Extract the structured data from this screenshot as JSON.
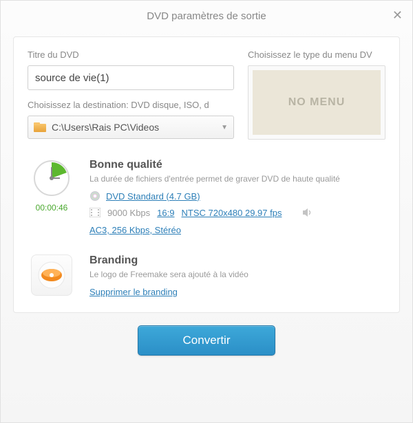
{
  "window": {
    "title": "DVD paramètres de sortie"
  },
  "labels": {
    "dvd_title": "Titre du DVD",
    "menu_type": "Choisissez le type du menu DV",
    "destination": "Choisissez la destination: DVD disque, ISO, d",
    "no_menu": "NO MENU"
  },
  "fields": {
    "title_value": "source de vie(1)",
    "destination_value": "C:\\Users\\Rais PC\\Videos"
  },
  "quality": {
    "title": "Bonne qualité",
    "subtitle": "La durée de fichiers d'entrée permet de graver DVD de haute qualité",
    "duration": "00:00:46",
    "disc_spec": "DVD Standard (4.7 GB)",
    "bitrate": "9000 Kbps",
    "aspect": "16:9",
    "video_std": "NTSC 720x480 29.97 fps",
    "audio": "AC3, 256 Kbps, Stéréo"
  },
  "branding": {
    "title": "Branding",
    "subtitle": "Le logo de Freemake sera ajouté à la vidéo",
    "remove_link": "Supprimer le branding"
  },
  "buttons": {
    "convert": "Convertir"
  }
}
